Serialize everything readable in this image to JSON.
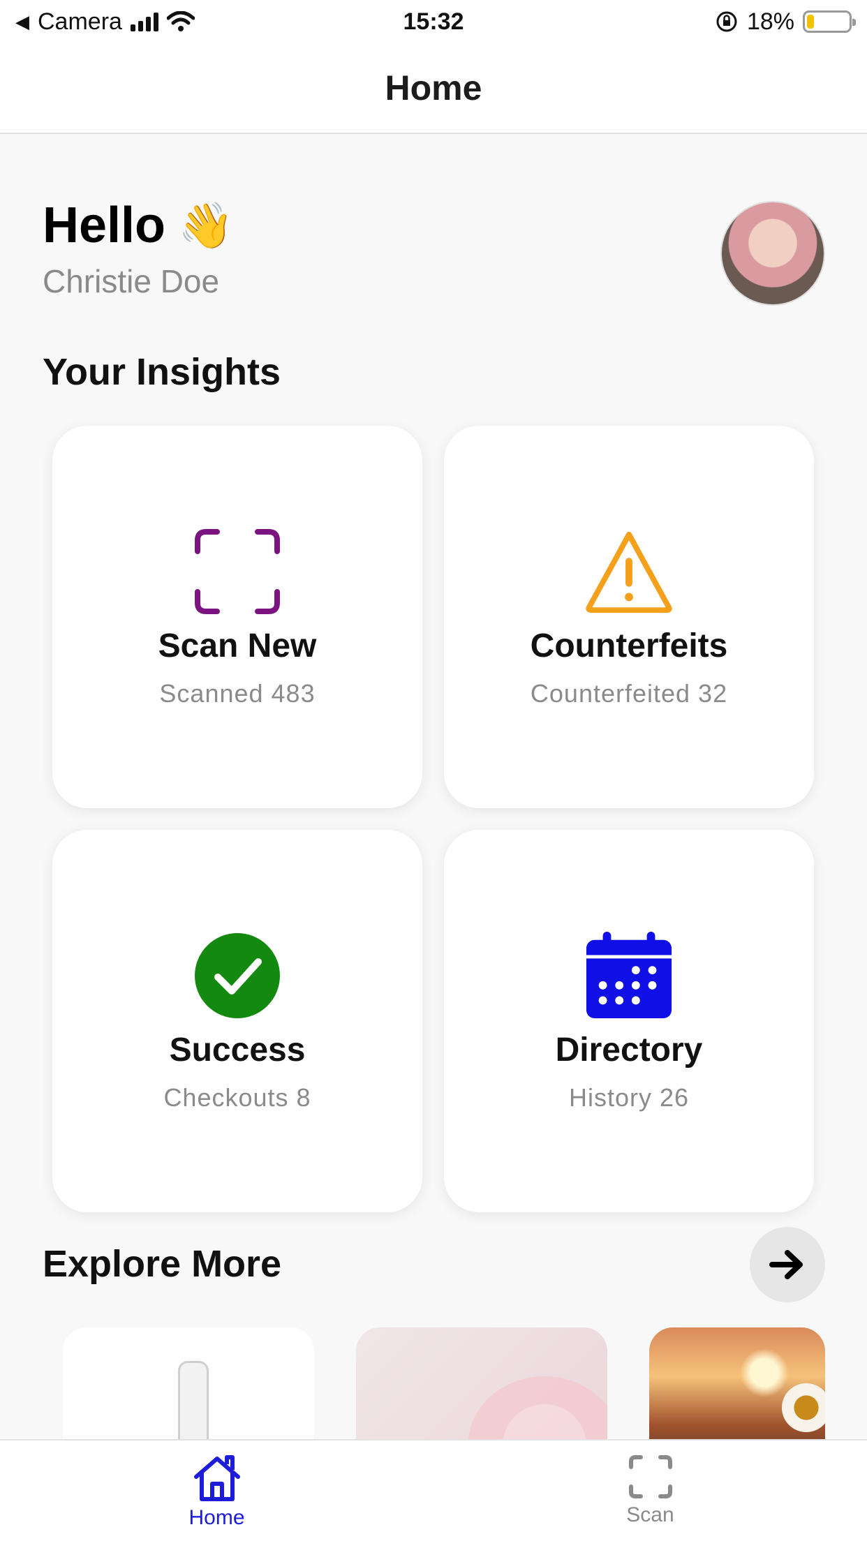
{
  "status_bar": {
    "back_app": "Camera",
    "time": "15:32",
    "battery_percent_text": "18%",
    "battery_level": 0.18
  },
  "navbar": {
    "title": "Home"
  },
  "greeting": {
    "hello": "Hello",
    "emoji": "👋",
    "name": "Christie Doe"
  },
  "insights": {
    "title": "Your Insights",
    "cards": [
      {
        "title": "Scan New",
        "subtitle": "Scanned 483",
        "icon": "scan-frame-icon",
        "color": "#7b1480"
      },
      {
        "title": "Counterfeits",
        "subtitle": "Counterfeited 32",
        "icon": "warning-triangle-icon",
        "color": "#f5a01a"
      },
      {
        "title": "Success",
        "subtitle": "Checkouts 8",
        "icon": "check-circle-icon",
        "color": "#138a0f"
      },
      {
        "title": "Directory",
        "subtitle": "History 26",
        "icon": "calendar-icon",
        "color": "#1010e6"
      }
    ]
  },
  "explore": {
    "title": "Explore More",
    "arrow_icon": "arrow-right-icon",
    "items": [
      {
        "name": "bottle-image"
      },
      {
        "name": "pink-flower-image"
      },
      {
        "name": "sunset-daisy-image"
      }
    ]
  },
  "tabbar": {
    "tabs": [
      {
        "label": "Home",
        "icon": "home-icon",
        "active": true,
        "color": "#1d1dd9"
      },
      {
        "label": "Scan",
        "icon": "scan-frame-icon",
        "active": false,
        "color": "#8a8a8a"
      }
    ]
  }
}
